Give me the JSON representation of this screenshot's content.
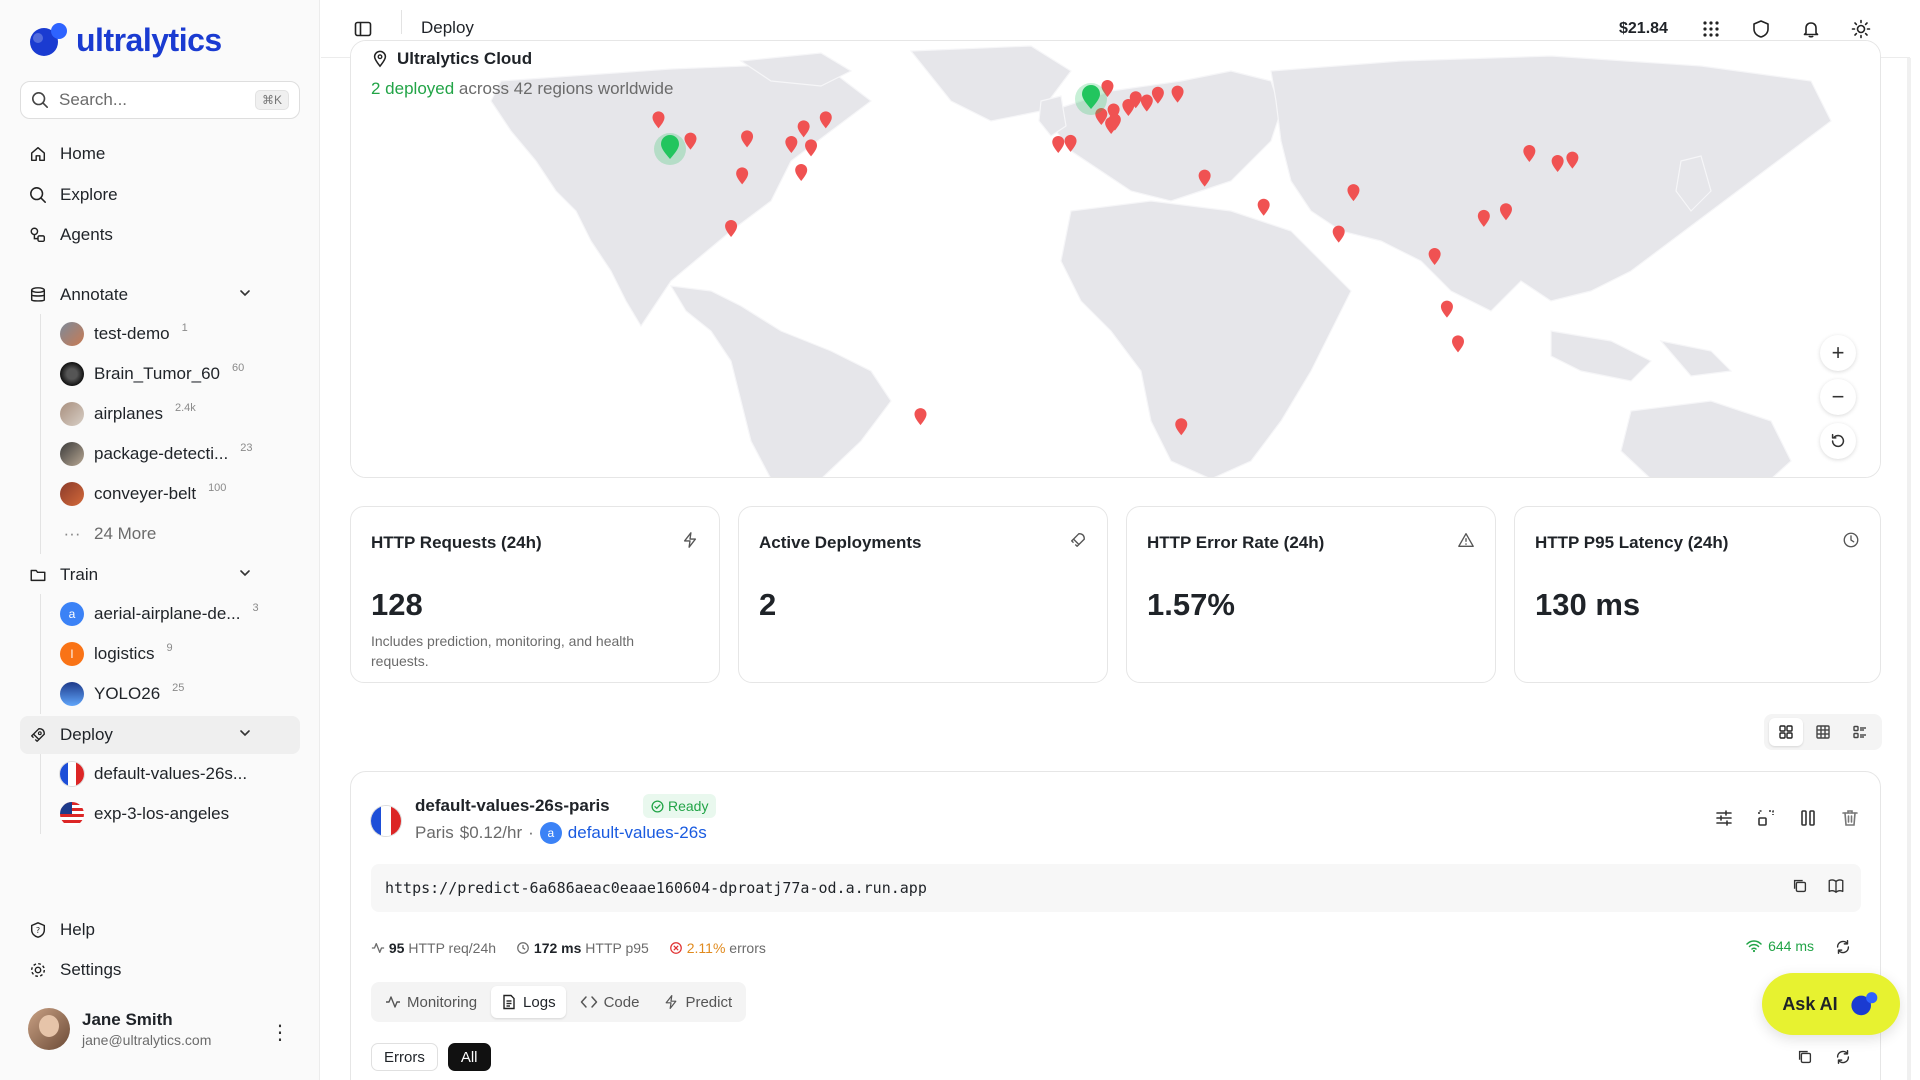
{
  "brand": {
    "name": "ultralytics",
    "color": "#1a3bd1"
  },
  "search": {
    "placeholder": "Search...",
    "shortcut": "⌘K"
  },
  "nav": {
    "home": "Home",
    "explore": "Explore",
    "agents": "Agents",
    "annotate": "Annotate",
    "train": "Train",
    "deploy": "Deploy",
    "help": "Help",
    "settings": "Settings"
  },
  "annotate_items": [
    {
      "label": "test-demo",
      "count": "1"
    },
    {
      "label": "Brain_Tumor_60",
      "count": "60"
    },
    {
      "label": "airplanes",
      "count": "2.4k"
    },
    {
      "label": "package-detecti...",
      "count": "23"
    },
    {
      "label": "conveyer-belt",
      "count": "100"
    }
  ],
  "annotate_more": "24 More",
  "train_items": [
    {
      "label": "aerial-airplane-de...",
      "count": "3",
      "initial": "a"
    },
    {
      "label": "logistics",
      "count": "9",
      "initial": "l"
    },
    {
      "label": "YOLO26",
      "count": "25"
    }
  ],
  "deploy_items": [
    {
      "label": "default-values-26s..."
    },
    {
      "label": "exp-3-los-angeles"
    }
  ],
  "user": {
    "name": "Jane Smith",
    "email": "jane@ultralytics.com"
  },
  "header": {
    "title": "Deploy",
    "balance": "$21.84"
  },
  "map": {
    "title": "Ultralytics Cloud",
    "deployed": "2 deployed",
    "regions_text": "across 42 regions worldwide",
    "zoom_in": "+",
    "zoom_out": "−"
  },
  "stats": [
    {
      "title": "HTTP Requests (24h)",
      "value": "128",
      "desc": "Includes prediction, monitoring, and health requests."
    },
    {
      "title": "Active Deployments",
      "value": "2",
      "desc": ""
    },
    {
      "title": "HTTP Error Rate (24h)",
      "value": "1.57%",
      "desc": ""
    },
    {
      "title": "HTTP P95 Latency (24h)",
      "value": "130 ms",
      "desc": ""
    }
  ],
  "deployment": {
    "name": "default-values-26s-paris",
    "status": "Ready",
    "city": "Paris",
    "price": "$0.12/hr",
    "model_initial": "a",
    "model": "default-values-26s",
    "url": "https://predict-6a686aeac0eaae160604-dproatj77a-od.a.run.app",
    "requests_value": "95",
    "requests_label": "HTTP req/24h",
    "p95_value": "172 ms",
    "p95_label": "HTTP p95",
    "errors_value": "2.11%",
    "errors_label": "errors",
    "latency": "644 ms",
    "tabs": [
      "Monitoring",
      "Logs",
      "Code",
      "Predict"
    ],
    "filters": [
      "Errors",
      "All"
    ]
  },
  "ask_ai": "Ask AI",
  "colors": {
    "ready": "#22a447",
    "pin": "#f05252",
    "active_pin": "#22c55e",
    "ask_ai_bg": "#e7f230"
  }
}
